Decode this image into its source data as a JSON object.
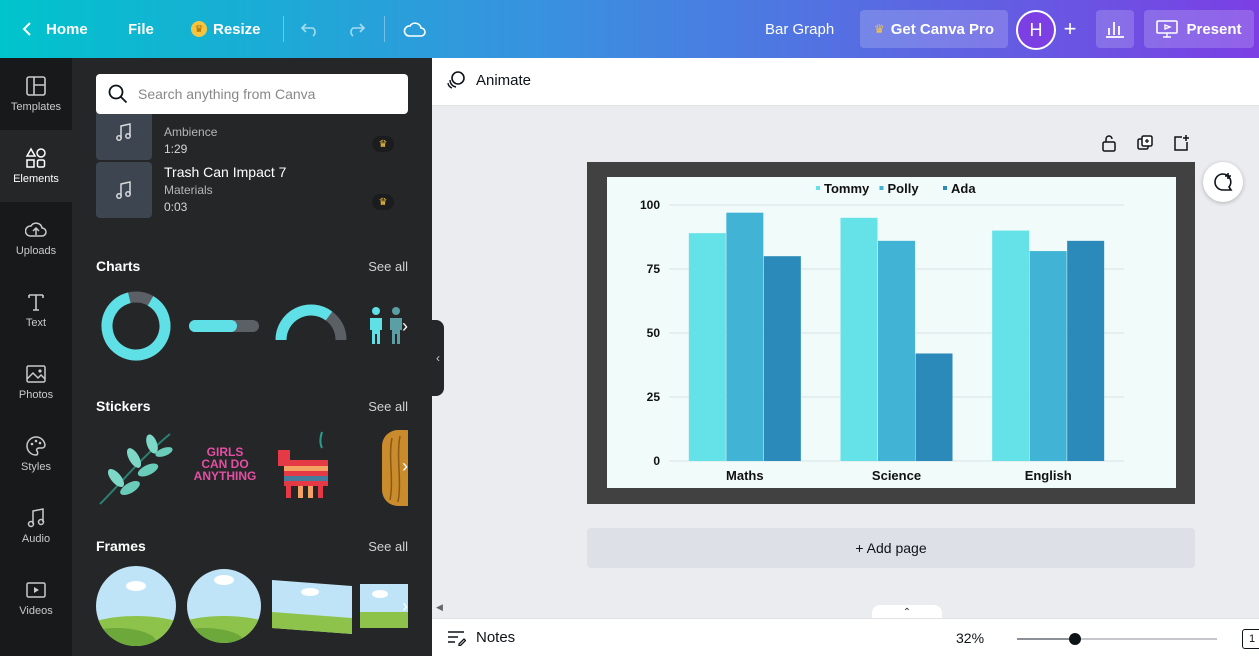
{
  "topbar": {
    "home_label": "Home",
    "file_label": "File",
    "resize_label": "Resize",
    "doc_title": "Bar Graph",
    "pro_label": "Get Canva Pro",
    "avatar_initial": "H",
    "present_label": "Present"
  },
  "rail": {
    "items": [
      {
        "label": "Templates",
        "icon": "templates-icon"
      },
      {
        "label": "Elements",
        "icon": "elements-icon"
      },
      {
        "label": "Uploads",
        "icon": "uploads-icon"
      },
      {
        "label": "Text",
        "icon": "text-icon"
      },
      {
        "label": "Photos",
        "icon": "photos-icon"
      },
      {
        "label": "Styles",
        "icon": "styles-icon"
      },
      {
        "label": "Audio",
        "icon": "audio-icon"
      },
      {
        "label": "Videos",
        "icon": "videos-icon"
      }
    ],
    "active": "Elements"
  },
  "panel": {
    "search_placeholder": "Search anything from Canva",
    "audio": [
      {
        "title": "",
        "subtitle": "Ambience",
        "duration": "1:29"
      },
      {
        "title": "Trash Can Impact 7",
        "subtitle": "Materials",
        "duration": "0:03"
      }
    ],
    "sections": [
      {
        "title": "Charts",
        "see_all": "See all"
      },
      {
        "title": "Stickers",
        "see_all": "See all"
      },
      {
        "title": "Frames",
        "see_all": "See all"
      }
    ],
    "sticker_text": [
      "GIRLS",
      "CAN DO",
      "ANYTHING"
    ]
  },
  "canvas": {
    "animate_label": "Animate",
    "add_page_label": "+ Add page",
    "notes_label": "Notes",
    "zoom": "32%",
    "zoom_fraction": 0.29,
    "page_count": "1"
  },
  "colors": {
    "tommy": "#64e2e8",
    "polly": "#41b4d6",
    "ada": "#2b8ab9",
    "accent": "#7b3fe4"
  },
  "chart_data": {
    "type": "bar",
    "categories": [
      "Maths",
      "Science",
      "English"
    ],
    "series": [
      {
        "name": "Tommy",
        "values": [
          89,
          95,
          90
        ]
      },
      {
        "name": "Polly",
        "values": [
          97,
          86,
          82
        ]
      },
      {
        "name": "Ada",
        "values": [
          80,
          42,
          86
        ]
      }
    ],
    "yticks": [
      "0",
      "25",
      "50",
      "75",
      "100"
    ],
    "ylim": [
      0,
      100
    ],
    "legend": "top-center",
    "grid": true
  }
}
